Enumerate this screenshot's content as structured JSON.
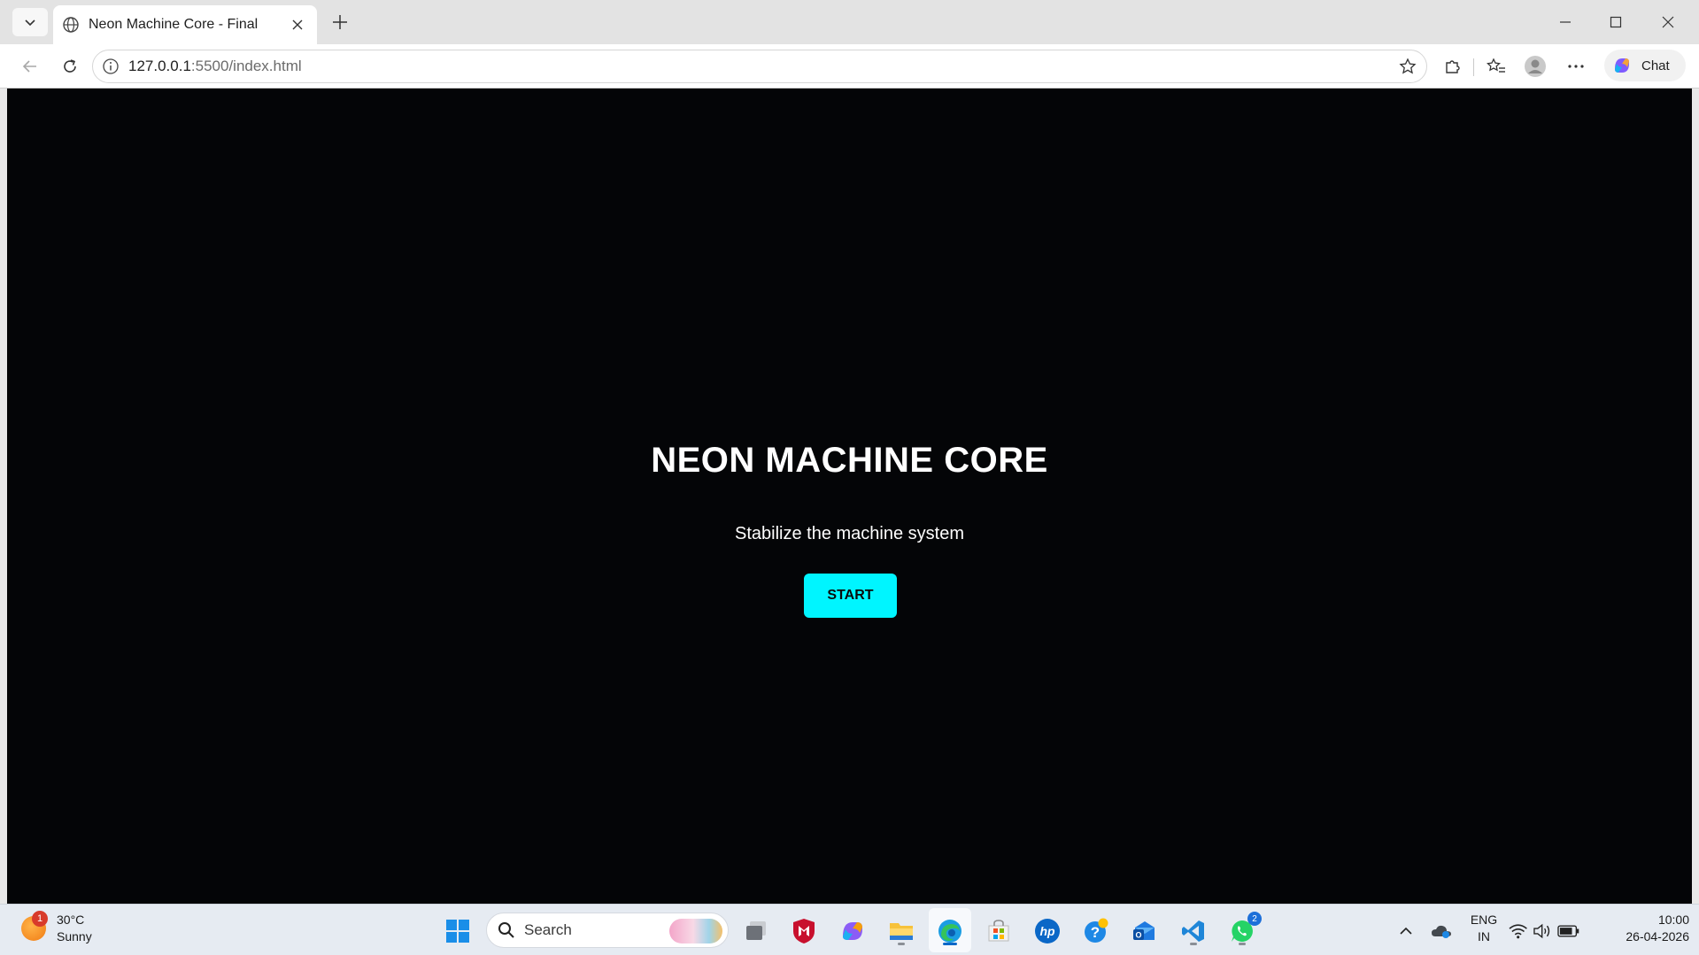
{
  "browser": {
    "tab": {
      "title": "Neon Machine Core - Final"
    },
    "address": {
      "host": "127.0.0.1",
      "path": ":5500/index.html"
    },
    "chat_label": "Chat"
  },
  "page": {
    "title": "NEON MACHINE CORE",
    "subtitle": "Stabilize the machine system",
    "start_label": "START",
    "accent_color": "#00f5ff",
    "background_color": "#040507"
  },
  "taskbar": {
    "weather": {
      "temp": "30°C",
      "condition": "Sunny",
      "badge": "1"
    },
    "search_placeholder": "Search",
    "pinned": [
      "windows-start-icon",
      "search",
      "task-view-icon",
      "mcafee-icon",
      "copilot-icon",
      "file-explorer-icon",
      "edge-icon",
      "microsoft-store-icon",
      "hp-icon",
      "get-help-icon",
      "outlook-icon",
      "vscode-icon",
      "whatsapp-icon"
    ],
    "whatsapp_badge": "2",
    "language": {
      "line1": "ENG",
      "line2": "IN"
    },
    "clock": {
      "time": "10:00",
      "date": "26-04-2026"
    }
  }
}
